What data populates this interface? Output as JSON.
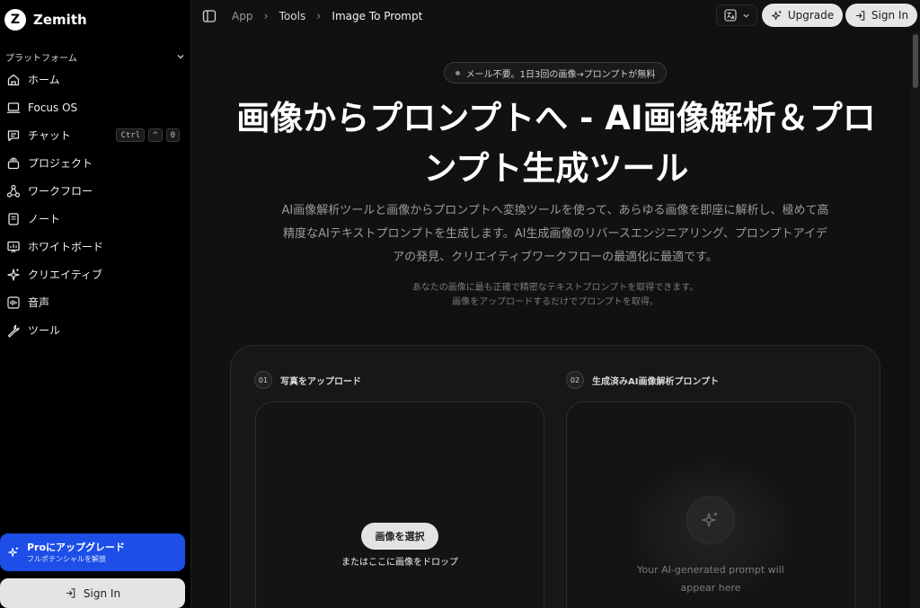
{
  "app": {
    "logo_letter": "Z",
    "name": "Zemith"
  },
  "sidebar": {
    "section_label": "プラットフォーム",
    "items": [
      {
        "label": "ホーム",
        "icon": "home-icon"
      },
      {
        "label": "Focus OS",
        "icon": "laptop-icon"
      },
      {
        "label": "チャット",
        "icon": "chat-icon",
        "shortcut": [
          "Ctrl",
          "^",
          "0"
        ]
      },
      {
        "label": "プロジェクト",
        "icon": "folder-stack-icon"
      },
      {
        "label": "ワークフロー",
        "icon": "workflow-icon"
      },
      {
        "label": "ノート",
        "icon": "notebook-icon"
      },
      {
        "label": "ホワイトボード",
        "icon": "whiteboard-icon"
      },
      {
        "label": "クリエイティブ",
        "icon": "sparkles-icon"
      },
      {
        "label": "音声",
        "icon": "audio-wave-icon"
      },
      {
        "label": "ツール",
        "icon": "wrench-icon"
      }
    ],
    "pro_card": {
      "title": "Proにアップグレード",
      "subtitle": "フルポテンシャルを解放"
    },
    "signin_label": "Sign In"
  },
  "topbar": {
    "breadcrumbs": [
      "App",
      "Tools",
      "Image To Prompt"
    ],
    "upgrade_label": "Upgrade",
    "signin_label": "Sign In"
  },
  "hero": {
    "badge": "メール不要。1日3回の画像→プロンプトが無料",
    "title": "画像からプロンプトへ - AI画像解析＆プロンプト生成ツール",
    "description": "AI画像解析ツールと画像からプロンプトへ変換ツールを使って、あらゆる画像を即座に解析し、極めて高精度なAIテキストプロンプトを生成します。AI生成画像のリバースエンジニアリング、プロンプトアイデアの発見、クリエイティブワークフローの最適化に最適です。",
    "note_line1": "あなたの画像に最も正確で精密なテキストプロンプトを取得できます。",
    "note_line2": "画像をアップロードするだけでプロンプトを取得。"
  },
  "tool": {
    "step1": {
      "number": "01",
      "label": "写真をアップロード"
    },
    "step2": {
      "number": "02",
      "label": "生成済みAI画像解析プロンプト"
    },
    "choose_button": "画像を選択",
    "drop_text": "またはここに画像をドロップ",
    "placeholder": "Your AI-generated prompt will appear here"
  },
  "colors": {
    "accent_blue": "#1d4ee8",
    "background": "#111111",
    "sidebar": "#000000"
  }
}
